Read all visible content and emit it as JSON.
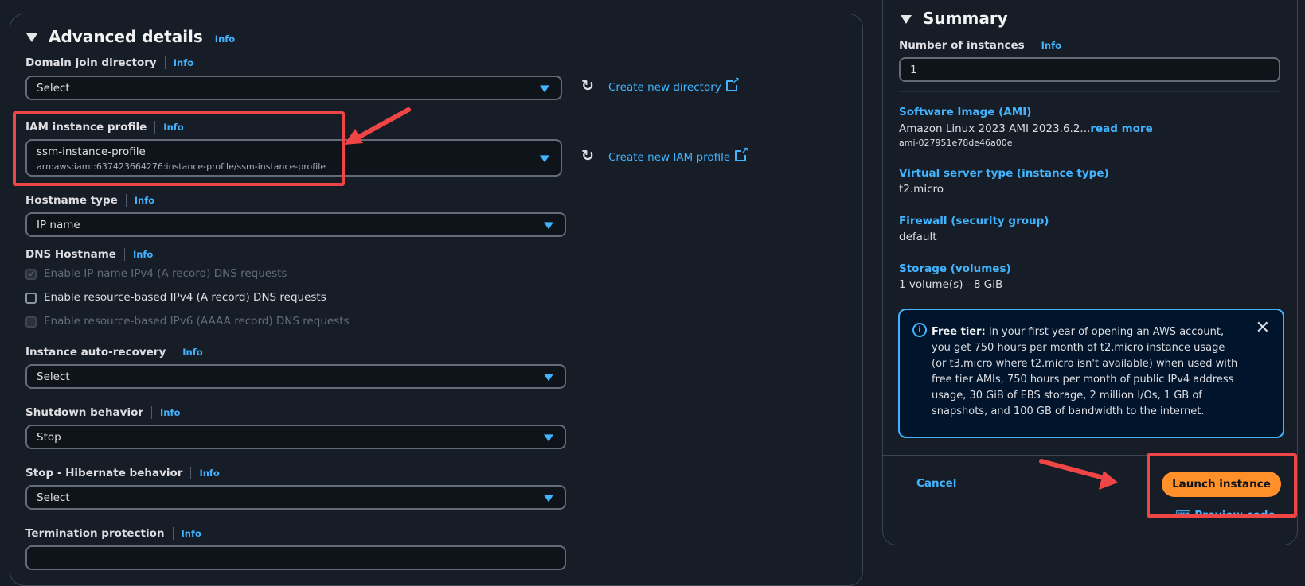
{
  "advanced": {
    "title": "Advanced details",
    "info": "Info",
    "fields": {
      "domain_join": {
        "label": "Domain join directory",
        "info": "Info",
        "value": "Select",
        "action": "Create new directory"
      },
      "iam_profile": {
        "label": "IAM instance profile",
        "info": "Info",
        "value": "ssm-instance-profile",
        "sub": "arn:aws:iam::637423664276:instance-profile/ssm-instance-profile",
        "action": "Create new IAM profile"
      },
      "hostname_type": {
        "label": "Hostname type",
        "info": "Info",
        "value": "IP name"
      },
      "dns_hostname": {
        "label": "DNS Hostname",
        "info": "Info",
        "options": [
          {
            "label": "Enable IP name IPv4 (A record) DNS requests",
            "checked": true,
            "disabled": true
          },
          {
            "label": "Enable resource-based IPv4 (A record) DNS requests",
            "checked": false,
            "disabled": false
          },
          {
            "label": "Enable resource-based IPv6 (AAAA record) DNS requests",
            "checked": false,
            "disabled": true
          }
        ]
      },
      "auto_recovery": {
        "label": "Instance auto-recovery",
        "info": "Info",
        "value": "Select"
      },
      "shutdown": {
        "label": "Shutdown behavior",
        "info": "Info",
        "value": "Stop"
      },
      "hibernate": {
        "label": "Stop - Hibernate behavior",
        "info": "Info",
        "value": "Select"
      },
      "termination": {
        "label": "Termination protection",
        "info": "Info"
      }
    }
  },
  "summary": {
    "title": "Summary",
    "num_instances": {
      "label": "Number of instances",
      "info": "Info",
      "value": "1"
    },
    "ami": {
      "key": "Software Image (AMI)",
      "value": "Amazon Linux 2023 AMI 2023.6.2...",
      "more": "read more",
      "id": "ami-027951e78de46a00e"
    },
    "instance_type": {
      "key": "Virtual server type (instance type)",
      "value": "t2.micro"
    },
    "firewall": {
      "key": "Firewall (security group)",
      "value": "default"
    },
    "storage": {
      "key": "Storage (volumes)",
      "value": "1 volume(s) - 8 GiB"
    },
    "free_tier": {
      "bold": "Free tier:",
      "text": " In your first year of opening an AWS account, you get 750 hours per month of t2.micro instance usage (or t3.micro where t2.micro isn't available) when used with free tier AMIs, 750 hours per month of public IPv4 address usage, 30 GiB of EBS storage, 2 million I/Os, 1 GB of snapshots, and 100 GB of bandwidth to the internet."
    },
    "cancel": "Cancel",
    "launch": "Launch instance",
    "preview": "Preview code"
  },
  "colors": {
    "accent": "#42b4ff",
    "launch": "#ff9029",
    "annotation": "#f04545",
    "background": "#161d26"
  }
}
